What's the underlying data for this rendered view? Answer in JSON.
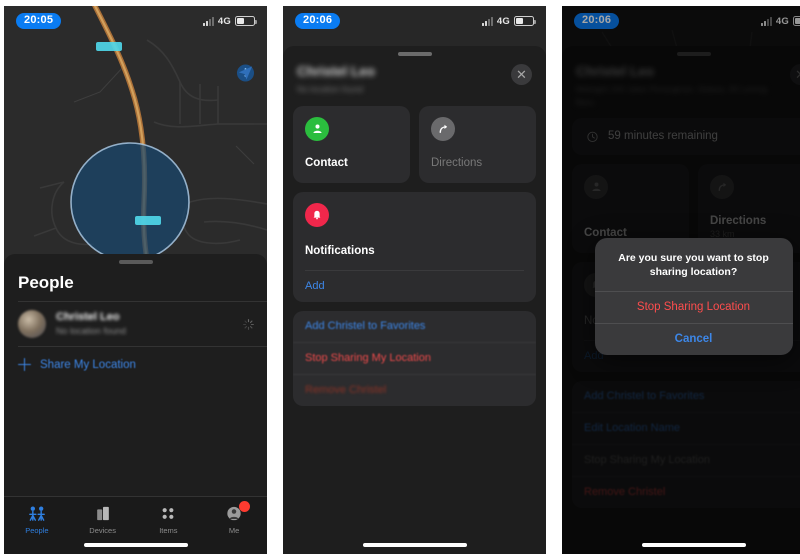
{
  "meta": {
    "accent_blue": "#3d87e8",
    "destructive_red": "#ff4d4d",
    "green": "#2bbd3e",
    "sheet_bg": "#1e1e1e",
    "card_bg": "#2c2c2e"
  },
  "panel1": {
    "status": {
      "time": "20:05",
      "network": "4G"
    },
    "map": {
      "controls": [
        {
          "icon": "info-circle-icon"
        },
        {
          "icon": "location-arrow-icon"
        }
      ]
    },
    "sheet": {
      "title": "People",
      "person": {
        "name": "Christel Leo",
        "subtitle": "No location found",
        "trailing_icon": "loading-spinner-icon"
      },
      "share": {
        "icon": "plus-icon",
        "label": "Share My Location"
      }
    },
    "tabbar": [
      {
        "label": "People",
        "icon": "people-icon",
        "active": true,
        "badge": false
      },
      {
        "label": "Devices",
        "icon": "devices-icon",
        "active": false,
        "badge": false
      },
      {
        "label": "Items",
        "icon": "items-icon",
        "active": false,
        "badge": false
      },
      {
        "label": "Me",
        "icon": "me-icon",
        "active": false,
        "badge": true
      }
    ]
  },
  "panel2": {
    "status": {
      "time": "20:06",
      "network": "4G"
    },
    "header": {
      "name": "Christel Leo",
      "subtitle": "No location found",
      "close_icon": "close-icon"
    },
    "cards": [
      {
        "title": "Contact",
        "icon": "person-icon",
        "icon_color": "green",
        "enabled": true
      },
      {
        "title": "Directions",
        "icon": "directions-arrow-icon",
        "icon_color": "gray",
        "enabled": false
      }
    ],
    "notifications": {
      "icon": "bell-icon",
      "title": "Notifications",
      "add_label": "Add"
    },
    "actions": [
      {
        "label": "Add Christel to Favorites",
        "style": "blue"
      },
      {
        "label": "Stop Sharing My Location",
        "style": "red"
      },
      {
        "label": "Remove Christel",
        "style": "dim-red"
      }
    ]
  },
  "panel3": {
    "status": {
      "time": "20:06",
      "network": "4G"
    },
    "header": {
      "name": "Christel Leo",
      "subtitle": "Midnight 240 Jalan Peranginan, Selasa, 30 Lorong Baru",
      "close_icon": "close-icon"
    },
    "eta": {
      "icon": "clock-icon",
      "text": "59 minutes remaining"
    },
    "cards": [
      {
        "title": "Contact",
        "subtitle": "",
        "icon": "person-icon",
        "icon_color": "dim"
      },
      {
        "title": "Directions",
        "subtitle": "33 km",
        "icon": "directions-arrow-icon",
        "icon_color": "dim"
      }
    ],
    "notifications": {
      "icon": "bell-icon",
      "title": "Notifications",
      "add_label": "Add"
    },
    "actions": [
      {
        "label": "Add Christel to Favorites",
        "style": "blue"
      },
      {
        "label": "Edit Location Name",
        "style": "blue"
      },
      {
        "label": "Stop Sharing My Location",
        "style": "dim-gray"
      },
      {
        "label": "Remove Christel",
        "style": "red"
      }
    ],
    "alert": {
      "title": "Are you sure you want to stop sharing location?",
      "confirm_label": "Stop Sharing Location",
      "cancel_label": "Cancel"
    }
  }
}
